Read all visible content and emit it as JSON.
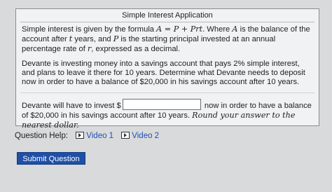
{
  "question": {
    "title": "Simple Interest Application",
    "p1": {
      "a": "Simple interest is given by the formula ",
      "formula": "A = P + Prt",
      "b": ". Where ",
      "a_var": "A",
      "c": " is the balance of the account after ",
      "t_var": "t",
      "d": " years, and ",
      "p_var": "P",
      "e": " is the starting principal invested at an annual percentage rate of ",
      "r_var": "r",
      "f": ", expressed as a decimal."
    },
    "p2": "Devante is investing money into a savings account that pays 2% simple interest, and plans to leave it there for 10 years. Determine what Devante needs to deposit now in order to have a balance of $20,000 in his savings account after 10 years.",
    "p3": {
      "before": "Devante will have to invest $",
      "after": " now in order to have a balance of $20,000 in his savings account after 10 years. ",
      "instruction": "Round your answer to the nearest dollar.",
      "answer_value": ""
    }
  },
  "help": {
    "label": "Question Help:",
    "links": [
      "Video 1",
      "Video 2"
    ]
  },
  "submit_label": "Submit Question"
}
